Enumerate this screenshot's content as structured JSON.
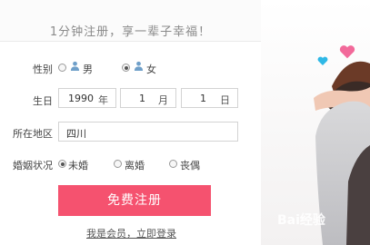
{
  "header": {
    "slogan": "1分钟注册，享一辈子幸福！"
  },
  "form": {
    "gender": {
      "label": "性别",
      "options": [
        {
          "label": "男",
          "selected": false,
          "icon": "male-avatar-icon"
        },
        {
          "label": "女",
          "selected": true,
          "icon": "female-avatar-icon"
        }
      ]
    },
    "birthday": {
      "label": "生日",
      "year": {
        "value": "1990",
        "unit": "年"
      },
      "month": {
        "value": "1",
        "unit": "月"
      },
      "day": {
        "value": "1",
        "unit": "日"
      }
    },
    "region": {
      "label": "所在地区",
      "value": "四川"
    },
    "marital": {
      "label": "婚姻状况",
      "options": [
        {
          "label": "未婚",
          "selected": true
        },
        {
          "label": "离婚",
          "selected": false
        },
        {
          "label": "丧偶",
          "selected": false
        }
      ]
    },
    "submit_label": "免费注册",
    "login_link": "我是会员，立即登录"
  },
  "watermark": {
    "text": "Bai经验"
  },
  "colors": {
    "accent": "#f5526f",
    "heart_pink": "#f2699a",
    "heart_blue": "#2fb8e6"
  }
}
